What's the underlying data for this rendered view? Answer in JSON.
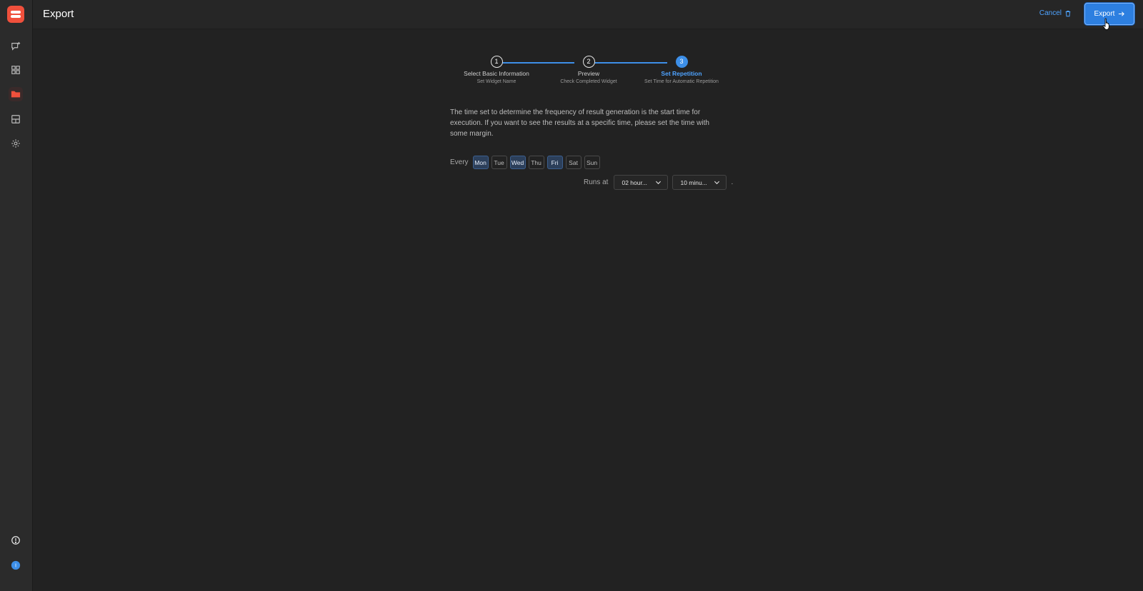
{
  "header": {
    "title": "Export",
    "cancel_label": "Cancel",
    "export_label": "Export"
  },
  "sidebar": {
    "items": [
      {
        "icon": "chat-plus-icon"
      },
      {
        "icon": "grid-icon"
      },
      {
        "icon": "folder-icon",
        "active": true
      },
      {
        "icon": "layout-icon"
      },
      {
        "icon": "gear-icon"
      }
    ],
    "bottom": [
      {
        "icon": "help-icon"
      },
      {
        "icon": "user-avatar-icon",
        "text": "I"
      }
    ]
  },
  "stepper": {
    "steps": [
      {
        "number": "1",
        "title": "Select Basic Information",
        "subtitle": "Set Widget Name",
        "active": false
      },
      {
        "number": "2",
        "title": "Preview",
        "subtitle": "Check Completed Widget",
        "active": false
      },
      {
        "number": "3",
        "title": "Set Repetition",
        "subtitle": "Set Time for Automatic Repetition",
        "active": true
      }
    ]
  },
  "main": {
    "description": "The time set to determine the frequency of result generation is the start time for execution. If you want to see the results at a specific time, please set the time with some margin.",
    "every_label": "Every",
    "days": [
      {
        "label": "Mon",
        "selected": true
      },
      {
        "label": "Tue",
        "selected": false
      },
      {
        "label": "Wed",
        "selected": true
      },
      {
        "label": "Thu",
        "selected": false
      },
      {
        "label": "Fri",
        "selected": true
      },
      {
        "label": "Sat",
        "selected": false
      },
      {
        "label": "Sun",
        "selected": false
      }
    ],
    "runs_at_label": "Runs at",
    "hour_select": "02 hour...",
    "minute_select": "10 minu...",
    "period": "."
  },
  "colors": {
    "accent": "#3d8fe8",
    "brand": "#f0503c",
    "background": "#222222"
  }
}
